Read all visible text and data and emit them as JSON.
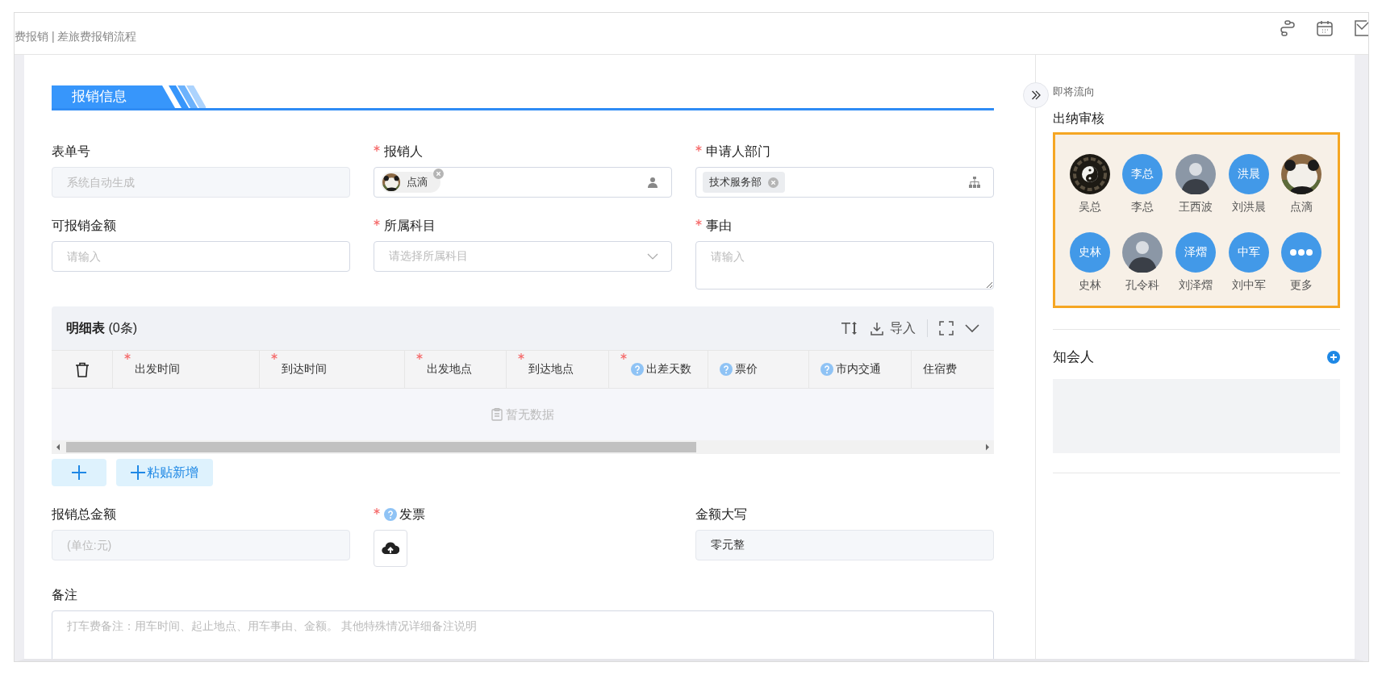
{
  "header": {
    "breadcrumb": "费报销 | 差旅费报销流程"
  },
  "section": {
    "title": "报销信息"
  },
  "fields_top": [
    {
      "label": "表单号",
      "required": false,
      "help": false,
      "kind": "input",
      "disabled": true,
      "placeholder": "系统自动生成"
    },
    {
      "label": "报销人",
      "required": true,
      "help": false,
      "kind": "user",
      "tag": "点滴"
    },
    {
      "label": "申请人部门",
      "required": true,
      "help": false,
      "kind": "dept",
      "tag": "技术服务部"
    },
    {
      "label": "可报销金额",
      "required": false,
      "help": false,
      "kind": "input",
      "disabled": false,
      "placeholder": "请输入"
    },
    {
      "label": "所属科目",
      "required": true,
      "help": false,
      "kind": "select",
      "placeholder": "请选择所属科目"
    },
    {
      "label": "事由",
      "required": true,
      "help": false,
      "kind": "textarea",
      "placeholder": "请输入"
    }
  ],
  "detail_table": {
    "title": "**明细表** (0条)",
    "import_label": "导入",
    "columns": [
      {
        "label": "出发时间",
        "required": true,
        "help": false
      },
      {
        "label": "到达时间",
        "required": true,
        "help": false
      },
      {
        "label": "出发地点",
        "required": true,
        "help": false
      },
      {
        "label": "到达地点",
        "required": true,
        "help": false
      },
      {
        "label": "出差天数",
        "required": true,
        "help": true
      },
      {
        "label": "票价",
        "required": false,
        "help": true
      },
      {
        "label": "市内交通",
        "required": false,
        "help": true
      },
      {
        "label": "住宿费",
        "required": false,
        "help": false
      }
    ],
    "empty_text": "暂无数据"
  },
  "add_buttons": {
    "paste_label": "粘贴新增"
  },
  "fields_bottom": [
    {
      "label": "报销总金额",
      "required": false,
      "help": false,
      "kind": "input",
      "disabled": true,
      "placeholder": "(单位:元)"
    },
    {
      "label": "发票",
      "required": true,
      "help": true,
      "kind": "upload"
    },
    {
      "label": "金额大写",
      "required": false,
      "help": false,
      "kind": "input",
      "disabled": true,
      "value": "零元整"
    }
  ],
  "remark": {
    "label": "备注",
    "placeholder": "打车费备注：用车时间、起止地点、用车事由、金额。 其他特殊情况详细备注说明"
  },
  "side": {
    "caption": "即将流向",
    "step": "出纳审核",
    "approvers": [
      {
        "name": "吴总",
        "kind": "symbol"
      },
      {
        "name": "李总",
        "kind": "initials",
        "initials": "李总"
      },
      {
        "name": "王西波",
        "kind": "person"
      },
      {
        "name": "刘洪晨",
        "kind": "initials",
        "initials": "洪晨"
      },
      {
        "name": "点滴",
        "kind": "animal"
      },
      {
        "name": "史林",
        "kind": "initials",
        "initials": "史林"
      },
      {
        "name": "孔令科",
        "kind": "person"
      },
      {
        "name": "刘泽熠",
        "kind": "initials",
        "initials": "泽熠"
      },
      {
        "name": "刘中军",
        "kind": "initials",
        "initials": "中军"
      },
      {
        "name": "更多",
        "kind": "more"
      }
    ],
    "cc_label": "知会人"
  }
}
